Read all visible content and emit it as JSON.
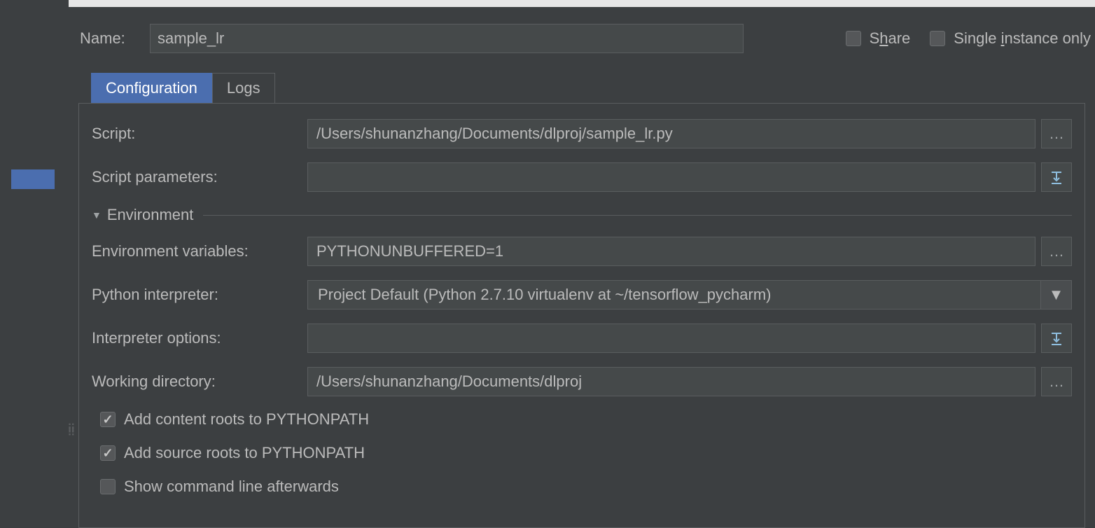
{
  "header": {
    "name_label": "Name:",
    "name_value": "sample_lr",
    "share_label_pre": "S",
    "share_label_ul": "h",
    "share_label_post": "are",
    "single_label_pre": "Single ",
    "single_label_ul": "i",
    "single_label_post": "nstance only"
  },
  "tabs": {
    "configuration": "Configuration",
    "logs": "Logs"
  },
  "form": {
    "script_label": "Script:",
    "script_value": "/Users/shunanzhang/Documents/dlproj/sample_lr.py",
    "script_params_label": "Script parameters:",
    "script_params_value": "",
    "environment_section": "Environment",
    "env_vars_label": "Environment variables:",
    "env_vars_value": "PYTHONUNBUFFERED=1",
    "interpreter_label": "Python interpreter:",
    "interpreter_value": "Project Default (Python 2.7.10 virtualenv at ~/tensorflow_pycharm)",
    "interpreter_options_label": "Interpreter options:",
    "interpreter_options_value": "",
    "working_dir_label": "Working directory:",
    "working_dir_value": "/Users/shunanzhang/Documents/dlproj",
    "add_content_roots": "Add content roots to PYTHONPATH",
    "add_source_roots": "Add source roots to PYTHONPATH",
    "show_command_line": "Show command line afterwards"
  }
}
